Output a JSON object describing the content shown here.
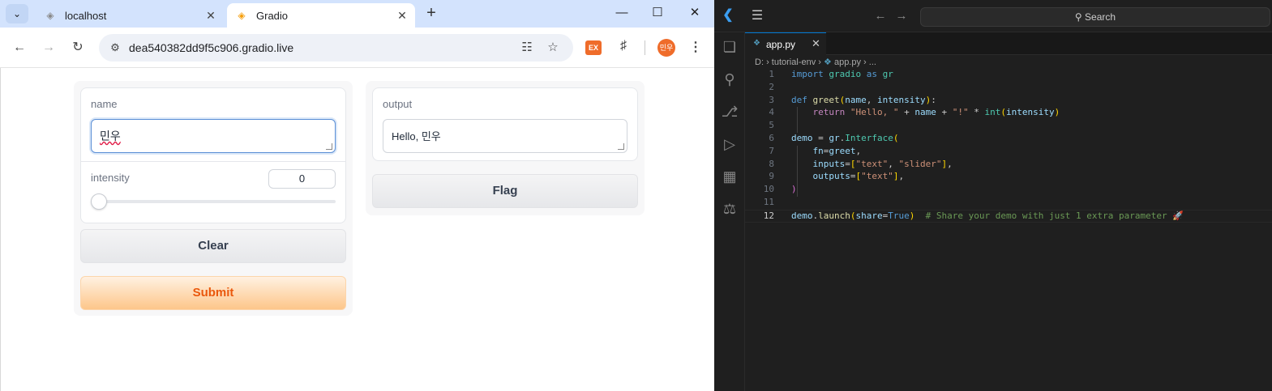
{
  "browser": {
    "tabs": [
      {
        "title": "localhost"
      },
      {
        "title": "Gradio"
      }
    ],
    "url": "dea540382dd9f5c906.gradio.live",
    "ext_badge": "EX",
    "profile_initials": "민우"
  },
  "gradio": {
    "name_label": "name",
    "name_value": "민우",
    "intensity_label": "intensity",
    "intensity_value": "0",
    "intensity_level": 0,
    "clear_label": "Clear",
    "submit_label": "Submit",
    "output_label": "output",
    "output_value": "Hello, 민우",
    "flag_label": "Flag"
  },
  "vscode": {
    "search_label": "Search",
    "tab": "app.py",
    "breadcrumbs": [
      "D:",
      "tutorial-env",
      "app.py",
      "..."
    ],
    "line_numbers": [
      "1",
      "2",
      "3",
      "4",
      "5",
      "6",
      "7",
      "8",
      "9",
      "10",
      "11",
      "12"
    ],
    "lines": [
      "import gradio as gr",
      "",
      "def greet(name, intensity):",
      "    return \"Hello, \" + name + \"!\" * int(intensity)",
      "",
      "demo = gr.Interface(",
      "    fn=greet,",
      "    inputs=[\"text\", \"slider\"],",
      "    outputs=[\"text\"],",
      ")",
      "",
      "demo.launch(share=True)  # Share your demo with just 1 extra parameter 🚀"
    ]
  },
  "colors": {
    "accent_orange": "#ea580c",
    "vscode_blue": "#0078d4"
  }
}
